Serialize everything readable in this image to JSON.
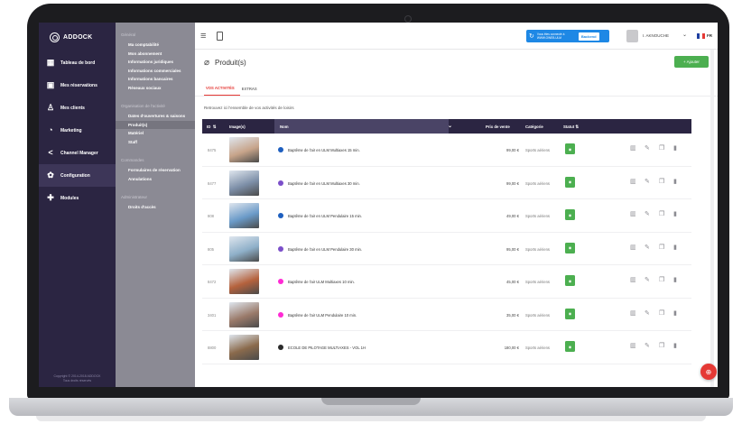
{
  "colors": {
    "sidebar": "#2b2542",
    "submenu": "#8b8a94",
    "accent_red": "#e53935",
    "accent_green": "#4caf50",
    "promo_blue": "#1e88e5"
  },
  "brand": {
    "name": "ADDOCK"
  },
  "sidebar": {
    "items": [
      {
        "label": "Tableau de bord",
        "icon": "dashboard-icon"
      },
      {
        "label": "Mes réservations",
        "icon": "calendar-icon"
      },
      {
        "label": "Mes clients",
        "icon": "user-icon"
      },
      {
        "label": "Marketing",
        "icon": "marketing-icon"
      },
      {
        "label": "Channel Manager",
        "icon": "share-icon"
      },
      {
        "label": "Configuration",
        "icon": "gear-icon",
        "active": true
      },
      {
        "label": "Modules",
        "icon": "puzzle-icon"
      }
    ],
    "copyright": "Copyright © 2014-2018 ADDOCK",
    "copyright_line2": "Tous droits réservés"
  },
  "submenu": {
    "group_general": "Général",
    "general_items": [
      "Ma comptabilité",
      "Mon abonnement",
      "Informations juridiques",
      "Informations commerciales",
      "Informations bancaires",
      "Réseaux sociaux"
    ],
    "group_org": "Organisation de l'activité",
    "org_items": [
      "Dates d'ouvertures & saisons",
      "Produit(s)",
      "Matériel",
      "Staff"
    ],
    "group_comm": "Commandes",
    "comm_items": [
      "Formulaires de réservation",
      "Annulations"
    ],
    "group_admin": "Administrateur",
    "admin_items": [
      "Droits d'accès"
    ]
  },
  "topbar": {
    "promo_text": "Vous êtes connecté à WWW.OWEB.ULM",
    "promo_button": "Backend",
    "user_name": "I. AKNOUCHE",
    "lang": "FR"
  },
  "page": {
    "title": "Produit(s)",
    "add_button": "+ Ajouter",
    "tabs": [
      "VOS ACTIVITÉS",
      "EXTRAS"
    ],
    "help": "Retrouvez ici l'ensemble de vos activités de loisirs"
  },
  "table": {
    "headers": {
      "id": "ID",
      "image": "Image(s)",
      "name": "Nom",
      "price": "Prix de vente",
      "category": "Catégorie",
      "status": "Statut"
    },
    "rows": [
      {
        "id": "8475",
        "name": "Baptême de l'air en ULM Multiaxes 15 min.",
        "price": "99,00 €",
        "category": "Sports aériens",
        "dot": "#1e5fbf",
        "thumb": "#c7a48a"
      },
      {
        "id": "8477",
        "name": "Baptême de l'air en ULM Multiaxes 30 min.",
        "price": "99,00 €",
        "category": "Sports aériens",
        "dot": "#7b4fc9",
        "thumb": "#7d8fa8"
      },
      {
        "id": "808",
        "name": "Baptême de l'air en ULM Pendulaire 15 min.",
        "price": "49,00 €",
        "category": "Sports aériens",
        "dot": "#1e5fbf",
        "thumb": "#6a9ac8"
      },
      {
        "id": "805",
        "name": "Baptême de l'air en ULM Pendulaire 30 min.",
        "price": "95,00 €",
        "category": "Sports aériens",
        "dot": "#7b4fc9",
        "thumb": "#8fb0c9"
      },
      {
        "id": "8472",
        "name": "Baptême de l'air ULM Multiaxes 10 min.",
        "price": "45,00 €",
        "category": "Sports aériens",
        "dot": "#ff2ad4",
        "thumb": "#b5623d"
      },
      {
        "id": "3401",
        "name": "Baptême de l'air ULM Pendulaire 10 min.",
        "price": "35,00 €",
        "category": "Sports aériens",
        "dot": "#ff2ad4",
        "thumb": "#9a7a6a"
      },
      {
        "id": "8800",
        "name": "ECOLE DE PILOTAGE MULTIAXES - VOL 1H",
        "price": "180,00 €",
        "category": "Sports aériens",
        "dot": "#2a2a2a",
        "thumb": "#8a6a4c"
      }
    ]
  }
}
